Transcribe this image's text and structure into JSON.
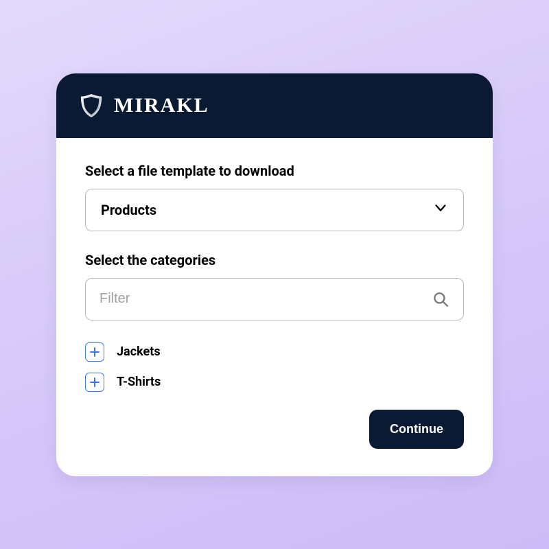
{
  "brand": {
    "name": "MIRAKL"
  },
  "template_section": {
    "label": "Select a file template to download",
    "selected": "Products"
  },
  "categories_section": {
    "label": "Select the categories",
    "filter_placeholder": "Filter",
    "items": [
      {
        "label": "Jackets"
      },
      {
        "label": "T-Shirts"
      }
    ]
  },
  "actions": {
    "continue": "Continue"
  },
  "colors": {
    "header_bg": "#0b1a33",
    "accent_blue": "#3a75ff"
  }
}
